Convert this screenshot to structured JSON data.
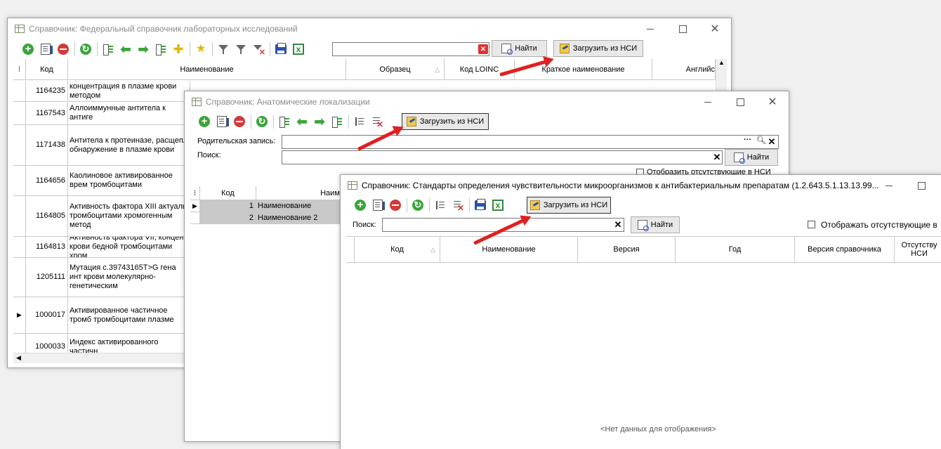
{
  "win1": {
    "title": "Справочник: Федеральный справочник лабораторных исследований",
    "find_label": "Найти",
    "load_label": "Загрузить из НСИ",
    "columns": [
      "Код",
      "Наименование",
      "Образец",
      "Код LOINC",
      "Краткое наименование",
      "Английс"
    ],
    "rows": [
      {
        "code": "1164235",
        "name": "Пресепсин, массовая концентрация в плазме крови методом иммунохемилюминесценции"
      },
      {
        "code": "1167543",
        "name": "Аллоиммунные антитела к антиге"
      },
      {
        "code": "1171438",
        "name": "Антитела к протеиназе, расщепл обнаружение в плазме крови"
      },
      {
        "code": "1164656",
        "name": "Каолиновое активированное врем тромбоцитами"
      },
      {
        "code": "1164805",
        "name": "Активность фактора XIII актуаль тромбоцитами хромогенным метод"
      },
      {
        "code": "1164813",
        "name": "Активность фактора VII, концент крови бедной тромбоцитами хром"
      },
      {
        "code": "1205111",
        "name": "Мутация c.39743165T>G гена инт крови молекулярно-генетическим"
      },
      {
        "code": "1000017",
        "name": "Активированное частичное тромб тромбоцитами плазме"
      },
      {
        "code": "1000033",
        "name": "Индекс активированного частичн"
      }
    ]
  },
  "win2": {
    "title": "Справочник: Анатомические локализации",
    "load_label": "Загрузить из НСИ",
    "parent_label": "Родительская запись:",
    "search_label": "Поиск:",
    "find_label": "Найти",
    "show_missing_label": "Отобразить отсутствующие в НСИ",
    "columns": [
      "Код",
      "Наиме"
    ],
    "rows": [
      {
        "code": "1",
        "name": "Наименование"
      },
      {
        "code": "2",
        "name": "Наименование 2"
      }
    ]
  },
  "win3": {
    "title": "Справочник: Стандарты определения чувствительности микроорганизмов к антибактериальным препаратам (1.2.643.5.1.13.13.99...",
    "load_label": "Загрузить из НСИ",
    "search_label": "Поиск:",
    "find_label": "Найти",
    "show_missing_label": "Отображать отсутствующие в",
    "columns": [
      "Код",
      "Наименование",
      "Версия",
      "Год",
      "Версия справочника",
      "Отсутству НСИ"
    ],
    "empty_text": "<Нет данных для отображения>"
  },
  "colors": {
    "accent_red": "#e02020",
    "green": "#3aa53a"
  }
}
